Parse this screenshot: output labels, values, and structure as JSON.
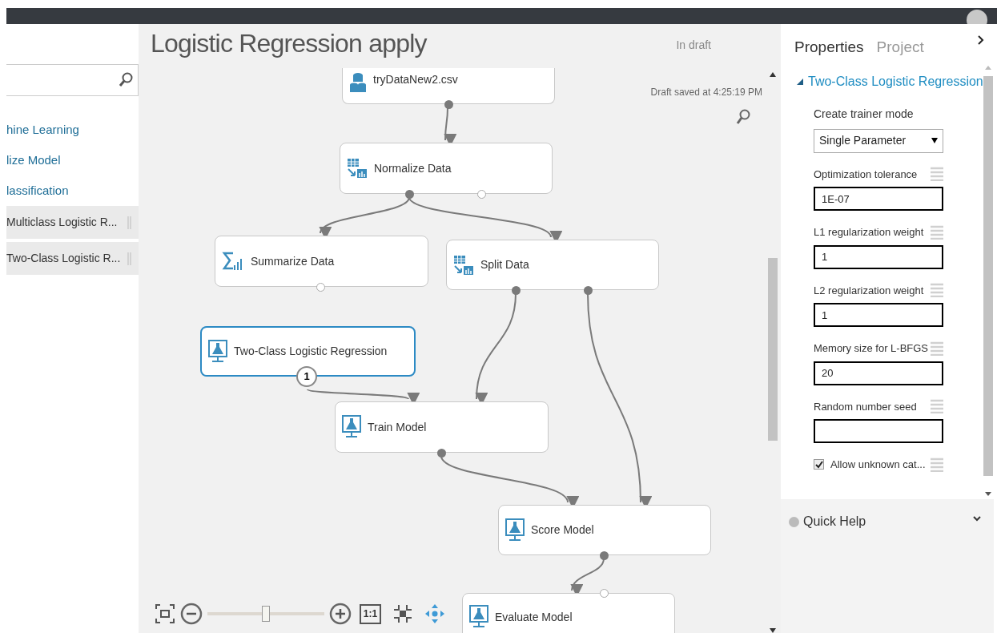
{
  "title": "Logistic Regression apply",
  "status": "In draft",
  "draft_saved": "Draft saved at 4:25:19 PM",
  "palette": {
    "items": [
      {
        "label": "hine Learning",
        "kind": "category"
      },
      {
        "label": "lize Model",
        "kind": "category"
      },
      {
        "label": "lassification",
        "kind": "category"
      },
      {
        "label": "Multiclass Logistic R...",
        "kind": "module"
      },
      {
        "label": "Two-Class Logistic R...",
        "kind": "module"
      }
    ]
  },
  "nodes": [
    {
      "label": "tryDataNew2.csv",
      "selected": false
    },
    {
      "label": "Normalize Data",
      "selected": false
    },
    {
      "label": "Summarize Data",
      "selected": false
    },
    {
      "label": "Split Data",
      "selected": false
    },
    {
      "label": "Two-Class Logistic Regression",
      "selected": true,
      "badge": "1"
    },
    {
      "label": "Train Model",
      "selected": false
    },
    {
      "label": "Score Model",
      "selected": false
    },
    {
      "label": "Evaluate Model",
      "selected": false
    }
  ],
  "zoom": {
    "level": 0.5,
    "actual_size": "1:1"
  },
  "properties": {
    "tabs": [
      {
        "label": "Properties",
        "selected": true
      },
      {
        "label": "Project",
        "selected": false
      }
    ],
    "section": {
      "title": "Two-Class Logistic Regression",
      "expanded": true
    },
    "fields": [
      {
        "kind": "select",
        "label": "Create trainer mode",
        "value": "Single Parameter"
      },
      {
        "kind": "text",
        "label": "Optimization tolerance",
        "value": "1E-07"
      },
      {
        "kind": "text",
        "label": "L1 regularization weight",
        "value": "1"
      },
      {
        "kind": "text",
        "label": "L2 regularization weight",
        "value": "1"
      },
      {
        "kind": "text",
        "label": "Memory size for L-BFGS",
        "value": "20"
      },
      {
        "kind": "text",
        "label": "Random number seed"
      },
      {
        "kind": "checkbox",
        "label": "Allow unknown cat...",
        "checked": true
      }
    ]
  },
  "quick_help": {
    "title": "Quick Help",
    "expanded": false
  }
}
